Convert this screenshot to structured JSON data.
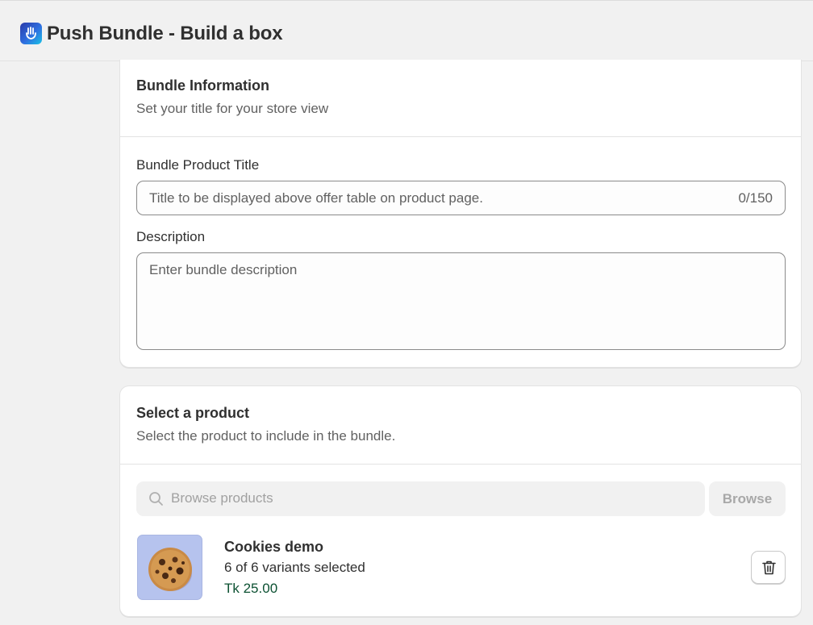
{
  "app": {
    "title": "Push Bundle - Build a box",
    "icon": "hand-app-icon"
  },
  "bundle_info": {
    "title": "Bundle Information",
    "subtitle": "Set your title for your store view",
    "product_title": {
      "label": "Bundle Product Title",
      "value": "",
      "placeholder": "Title to be displayed above offer table on product page.",
      "counter": "0/150"
    },
    "description": {
      "label": "Description",
      "value": "",
      "placeholder": "Enter bundle description"
    }
  },
  "select_product": {
    "title": "Select a product",
    "subtitle": "Select the product to include in the bundle.",
    "search": {
      "placeholder": "Browse products",
      "icon": "search-icon"
    },
    "browse_label": "Browse",
    "selected_product": {
      "name": "Cookies demo",
      "variants": "6 of 6 variants selected",
      "price": "Tk 25.00",
      "image": "cookie-image",
      "delete_icon": "trash-icon"
    }
  },
  "colors": {
    "background": "#f1f1f1",
    "card": "#ffffff",
    "text": "#303030",
    "subdued": "#616161",
    "price": "#0c5132",
    "thumb_bg": "#b6c3ee"
  }
}
